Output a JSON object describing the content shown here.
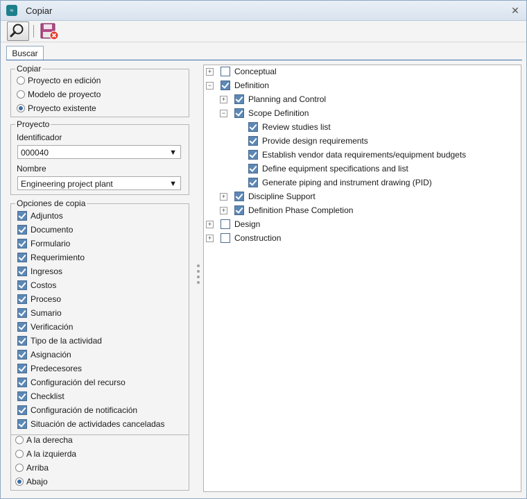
{
  "window": {
    "title": "Copiar"
  },
  "tabs": [
    {
      "label": "Buscar"
    }
  ],
  "copiar": {
    "legend": "Copiar",
    "options": [
      {
        "label": "Proyecto en edición",
        "selected": false
      },
      {
        "label": "Modelo de proyecto",
        "selected": false
      },
      {
        "label": "Proyecto existente",
        "selected": true
      }
    ]
  },
  "proyecto": {
    "legend": "Proyecto",
    "identificador_label": "Identificador",
    "identificador_value": "000040",
    "nombre_label": "Nombre",
    "nombre_value": "Engineering project plant"
  },
  "opciones": {
    "legend": "Opciones de copia",
    "items": [
      {
        "label": "Adjuntos",
        "checked": true
      },
      {
        "label": "Documento",
        "checked": true
      },
      {
        "label": "Formulario",
        "checked": true
      },
      {
        "label": "Requerimiento",
        "checked": true
      },
      {
        "label": "Ingresos",
        "checked": true
      },
      {
        "label": "Costos",
        "checked": true
      },
      {
        "label": "Proceso",
        "checked": true
      },
      {
        "label": "Sumario",
        "checked": true
      },
      {
        "label": "Verificación",
        "checked": true
      },
      {
        "label": "Tipo de la actividad",
        "checked": true
      },
      {
        "label": "Asignación",
        "checked": true
      },
      {
        "label": "Predecesores",
        "checked": true
      },
      {
        "label": "Configuración del recurso",
        "checked": true
      },
      {
        "label": "Checklist",
        "checked": true
      },
      {
        "label": "Configuración de notificación",
        "checked": true
      },
      {
        "label": "Situación de actividades canceladas",
        "checked": true
      }
    ]
  },
  "posicion": {
    "options": [
      {
        "label": "A la derecha",
        "selected": false
      },
      {
        "label": "A la izquierda",
        "selected": false
      },
      {
        "label": "Arriba",
        "selected": false
      },
      {
        "label": "Abajo",
        "selected": true
      }
    ]
  },
  "tree": [
    {
      "label": "Conceptual",
      "level": 0,
      "expander": "+",
      "checked": false
    },
    {
      "label": "Definition",
      "level": 0,
      "expander": "−",
      "checked": true
    },
    {
      "label": "Planning and Control",
      "level": 1,
      "expander": "+",
      "checked": true
    },
    {
      "label": "Scope Definition",
      "level": 1,
      "expander": "−",
      "checked": true
    },
    {
      "label": "Review studies list",
      "level": 2,
      "expander": "",
      "checked": true
    },
    {
      "label": "Provide design requirements",
      "level": 2,
      "expander": "",
      "checked": true
    },
    {
      "label": "Establish vendor data requirements/equipment budgets",
      "level": 2,
      "expander": "",
      "checked": true
    },
    {
      "label": "Define equipment specifications and list",
      "level": 2,
      "expander": "",
      "checked": true
    },
    {
      "label": "Generate piping and instrument drawing (PID)",
      "level": 2,
      "expander": "",
      "checked": true
    },
    {
      "label": "Discipline Support",
      "level": 1,
      "expander": "+",
      "checked": true
    },
    {
      "label": "Definition Phase Completion",
      "level": 1,
      "expander": "+",
      "checked": true
    },
    {
      "label": "Design",
      "level": 0,
      "expander": "+",
      "checked": false
    },
    {
      "label": "Construction",
      "level": 0,
      "expander": "+",
      "checked": false
    }
  ],
  "icons": {
    "app": "app-logo-icon",
    "close": "close-icon",
    "search": "magnifier-icon",
    "cancel": "save-cancel-icon",
    "accent": "#3b6da8"
  }
}
